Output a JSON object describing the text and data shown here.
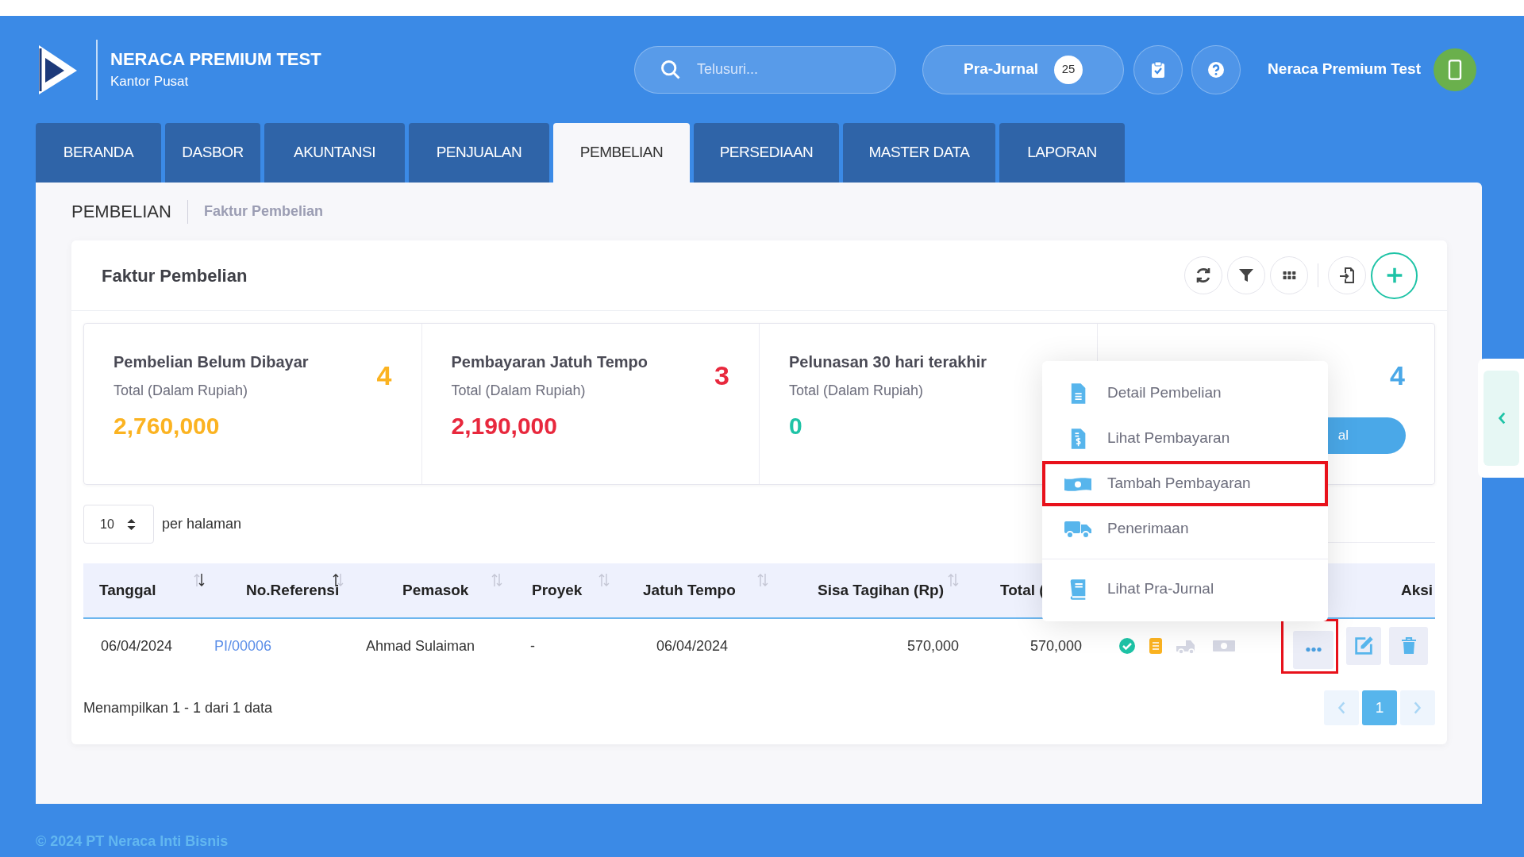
{
  "header": {
    "brand": "NERACA PREMIUM TEST",
    "branch": "Kantor Pusat",
    "search": {
      "placeholder": "Telusuri..."
    },
    "pra_jurnal": {
      "label": "Pra-Jurnal",
      "count": "25"
    },
    "user": "Neraca Premium Test"
  },
  "tabs": [
    {
      "label": "BERANDA",
      "selected": false
    },
    {
      "label": "DASBOR",
      "selected": false
    },
    {
      "label": "AKUNTANSI",
      "selected": false
    },
    {
      "label": "PENJUALAN",
      "selected": false
    },
    {
      "label": "PEMBELIAN",
      "selected": true
    },
    {
      "label": "PERSEDIAAN",
      "selected": false
    },
    {
      "label": "MASTER DATA",
      "selected": false
    },
    {
      "label": "LAPORAN",
      "selected": false
    }
  ],
  "breadcrumb": {
    "section": "PEMBELIAN",
    "page": "Faktur Pembelian"
  },
  "card_title": "Faktur Pembelian",
  "stats": [
    {
      "title": "Pembelian Belum Dibayar",
      "subtitle": "Total (Dalam Rupiah)",
      "count": "4",
      "amount": "2,760,000",
      "color": "#fbb321"
    },
    {
      "title": "Pembayaran Jatuh Tempo",
      "subtitle": "Total (Dalam Rupiah)",
      "count": "3",
      "amount": "2,190,000",
      "color": "#e8283d"
    },
    {
      "title": "Pelunasan 30 hari terakhir",
      "subtitle": "Total (Dalam Rupiah)",
      "amount": "0",
      "color": "#1ec3a6"
    },
    {
      "count": "4",
      "button": "al",
      "color": "#4aa8e8"
    }
  ],
  "page_size": {
    "value": "10",
    "label": "per halaman"
  },
  "table": {
    "columns": [
      {
        "label": "Tanggal",
        "sort_up": false,
        "sort_down": true
      },
      {
        "label": "No.Referensi",
        "sort_up": true,
        "sort_down": false
      },
      {
        "label": "Pemasok",
        "sort_up": false,
        "sort_down": false
      },
      {
        "label": "Proyek",
        "sort_up": false,
        "sort_down": false
      },
      {
        "label": "Jatuh Tempo",
        "sort_up": false,
        "sort_down": false
      },
      {
        "label": "Sisa Tagihan (Rp)",
        "sort_up": false,
        "sort_down": false
      },
      {
        "label": "Total ("
      },
      {
        "label": "Aksi"
      }
    ],
    "rows": [
      {
        "cells": [
          "06/04/2024",
          "PI/00006",
          "Ahmad Sulaiman",
          "-",
          "06/04/2024",
          "570,000",
          "570,000"
        ],
        "status": [
          {
            "kind": "check",
            "active": true
          },
          {
            "kind": "journal",
            "active": true
          },
          {
            "kind": "truck",
            "active": false
          },
          {
            "kind": "money",
            "active": false
          }
        ],
        "more_highlighted": true
      }
    ]
  },
  "summary": "Menampilkan 1 - 1 dari 1 data",
  "pagination": {
    "pages": [
      {
        "label": "1",
        "selected": true
      }
    ]
  },
  "menu": {
    "items": [
      {
        "label": "Detail Pembelian",
        "kind": "document",
        "highlighted": false
      },
      {
        "label": "Lihat Pembayaran",
        "kind": "invoice",
        "highlighted": false
      },
      {
        "label": "Tambah Pembayaran",
        "kind": "money",
        "highlighted": true
      },
      {
        "label": "Penerimaan",
        "kind": "truck",
        "highlighted": false
      },
      {
        "label": "Lihat Pra-Jurnal",
        "kind": "book",
        "highlighted": false
      }
    ]
  },
  "footer": "© 2024 PT Neraca Inti Bisnis"
}
